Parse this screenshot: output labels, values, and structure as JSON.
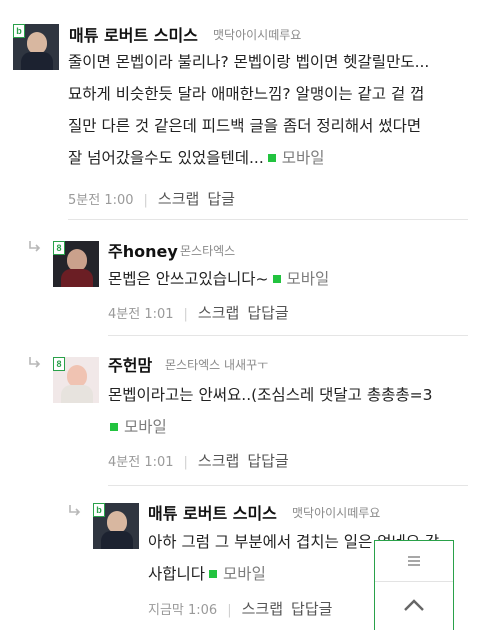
{
  "comments": [
    {
      "nick": "매튜 로버트 스미스",
      "level": "맷닥아이시떼루요",
      "lines": [
        "줄이면 몬벱이라 불리나? 몬벱이랑 벱이면 헷갈릴만도...",
        "묘하게 비슷한듯 달라 애매한느낌? 알맹이는 같고 겉 껍",
        "질만 다른 것 같은데 피드백 글을 좀더 정리해서 썼다면",
        "잘 넘어갔을수도 있었을텐데..."
      ],
      "mobile": "모바일",
      "time": "5분전 1:00",
      "scrap": "스크랩",
      "reply": "답글"
    },
    {
      "nick": "주honey",
      "level": "몬스타엑스",
      "lines": [
        "몬벱은 안쓰고있습니다~"
      ],
      "mobile": "모바일",
      "time": "4분전 1:01",
      "scrap": "스크랩",
      "reply": "답답글"
    },
    {
      "nick": "주헌맘",
      "level": "몬스타엑스 내새꾸ㅜ",
      "lines": [
        "몬벱이라고는 안써요..(조심스레 댓달고 총총총=3"
      ],
      "mobile": "모바일",
      "time": "4분전 1:01",
      "scrap": "스크랩",
      "reply": "답답글"
    },
    {
      "nick": "매튜 로버트 스미스",
      "level": "맷닥아이시떼루요",
      "lines": [
        "아하 그럼 그 부분에서 겹치는 일은 없네요 감",
        "사합니다"
      ],
      "mobile": "모바일",
      "time": "지금막 1:06",
      "scrap": "스크랩",
      "reply": "답답글"
    }
  ],
  "badge_letter": "b",
  "badge_letter_alt": "8",
  "icons": {
    "reply_arrow": "reply-arrow-icon",
    "menu": "hamburger-icon",
    "scroll_up": "chevron-up-icon"
  },
  "colors": {
    "mobile_dot": "#22c33f",
    "widget_border": "#2aa14a"
  }
}
